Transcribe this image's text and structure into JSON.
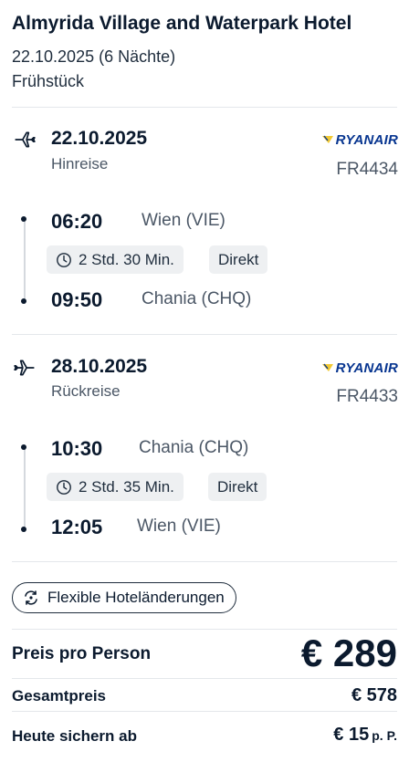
{
  "hotel": {
    "title": "Almyrida Village and Waterpark Hotel",
    "dates": "22.10.2025 (6 Nächte)",
    "board": "Frühstück"
  },
  "outbound": {
    "icon": "plane-departure-icon",
    "date": "22.10.2025",
    "label": "Hinreise",
    "airline": "RYANAIR",
    "flight_number": "FR4434",
    "depart_time": "06:20",
    "depart_city": "Wien (VIE)",
    "duration": "2 Std. 30 Min.",
    "stops": "Direkt",
    "arrive_time": "09:50",
    "arrive_city": "Chania (CHQ)"
  },
  "return": {
    "icon": "plane-arrival-icon",
    "date": "28.10.2025",
    "label": "Rückreise",
    "airline": "RYANAIR",
    "flight_number": "FR4433",
    "depart_time": "10:30",
    "depart_city": "Chania (CHQ)",
    "duration": "2 Std. 35 Min.",
    "stops": "Direkt",
    "arrive_time": "12:05",
    "arrive_city": "Wien (VIE)"
  },
  "flex_button": {
    "label": "Flexible Hoteländerungen",
    "icon": "flex-change-icon"
  },
  "pricing": {
    "per_person_label": "Preis pro Person",
    "per_person_value": "€ 289",
    "total_label": "Gesamtpreis",
    "total_value": "€ 578",
    "today_label": "Heute sichern ab",
    "today_value": "€ 15",
    "today_unit": "p. P."
  },
  "colors": {
    "text_primary": "#0b1a2e",
    "text_secondary": "#4b5766",
    "chip_bg": "#eef0f2",
    "divider": "#e4e7eb",
    "ryanair_blue": "#073590",
    "ryanair_yellow": "#f1c933"
  }
}
